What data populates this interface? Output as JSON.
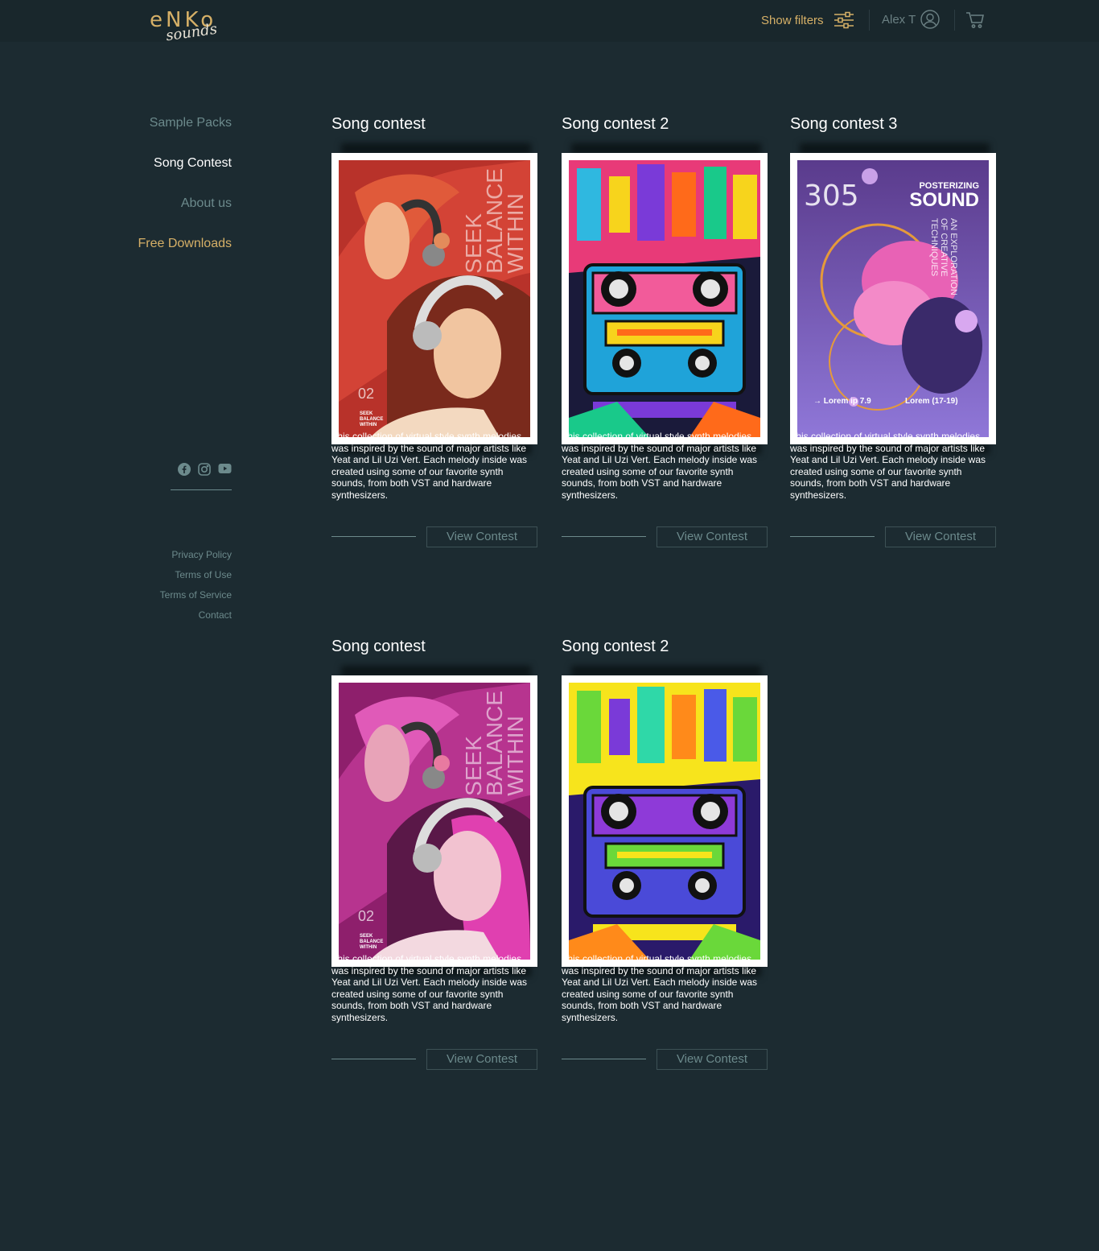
{
  "header": {
    "logo_main": "eNKo",
    "logo_script": "sounds",
    "show_filters": "Show filters",
    "user_name": "Alex T"
  },
  "sidebar": {
    "items": [
      {
        "label": "Sample Packs"
      },
      {
        "label": "Song Contest"
      },
      {
        "label": "About us"
      },
      {
        "label": "Free Downloads"
      }
    ],
    "legal": [
      "Privacy Policy",
      "Terms of Use",
      "Terms of Service",
      "Contact"
    ]
  },
  "contests": [
    {
      "title": "Song contest",
      "cta": "View Contest",
      "desc": "This collection of virtual style synth melodies was inspired by the sound of major artists like Yeat and Lil Uzi Vert. Each melody inside was created using some of our favorite synth sounds, from both VST and hardware synthesizers.",
      "art": {
        "poster_title_lines": [
          "SEEK",
          "BALANCE",
          "WITHIN"
        ],
        "number": "02",
        "small_caption": "SEEK BALANCE WITHIN"
      }
    },
    {
      "title": "Song contest 2",
      "cta": "View Contest",
      "desc": "This collection of virtual style synth melodies was inspired by the sound of major artists like Yeat and Lil Uzi Vert. Each melody inside was created using some of our favorite synth sounds, from both VST and hardware synthesizers."
    },
    {
      "title": "Song contest 3",
      "cta": "View Contest",
      "desc": "This collection of virtual style synth melodies was inspired by the sound of major artists like Yeat and Lil Uzi Vert. Each melody inside was created using some of our favorite synth sounds, from both VST and hardware synthesizers.",
      "art": {
        "number": "305",
        "kicker": "POSTERIZING",
        "headline": "SOUND",
        "side_text": [
          "AN EXPLORATION",
          "OF CREATIVE",
          "TECHNIQUES"
        ],
        "left_caption": "Lorem ip 7.9",
        "right_caption": "Lorem (17-19)"
      }
    },
    {
      "title": "Song contest",
      "cta": "View Contest",
      "desc": "This collection of virtual style synth melodies was inspired by the sound of major artists like Yeat and Lil Uzi Vert. Each melody inside was created using some of our favorite synth sounds, from both VST and hardware synthesizers.",
      "art": {
        "poster_title_lines": [
          "SEEK",
          "BALANCE",
          "WITHIN"
        ],
        "number": "02",
        "small_caption": "SEEK BALANCE WITHIN"
      }
    },
    {
      "title": "Song contest 2",
      "cta": "View Contest",
      "desc": "This collection of virtual style synth melodies was inspired by the sound of major artists like Yeat and Lil Uzi Vert. Each melody inside was created using some of our favorite synth sounds, from both VST and hardware synthesizers."
    }
  ],
  "colors": {
    "background": "#1c2b31",
    "accent": "#d6b067",
    "muted": "#6c8a8c"
  }
}
